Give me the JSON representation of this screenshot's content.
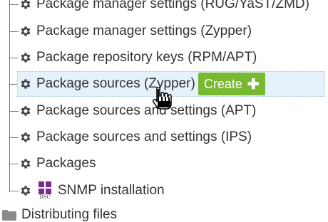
{
  "tree": {
    "items": [
      {
        "label": "Package manager settings (RUG/YaST/ZMD)",
        "icon": "gear-icon"
      },
      {
        "label": "Package manager settings (Zypper)",
        "icon": "gear-icon"
      },
      {
        "label": "Package repository keys (RPM/APT)",
        "icon": "gear-icon"
      },
      {
        "label": "Package sources (Zypper)",
        "icon": "gear-icon",
        "selected": true
      },
      {
        "label": "Package sources and settings (APT)",
        "icon": "gear-icon"
      },
      {
        "label": "Package sources and settings (IPS)",
        "icon": "gear-icon"
      },
      {
        "label": "Packages",
        "icon": "gear-icon"
      },
      {
        "label": "SNMP installation",
        "icon": "gear-icon",
        "extra_icon": "windows-icon",
        "extra_icon_caption": "DSC"
      }
    ],
    "create_button": {
      "label": "Create",
      "icon": "plus-icon"
    },
    "folder": {
      "label": "Distributing files",
      "icon": "folder-icon"
    }
  },
  "colors": {
    "highlight_bg": "#e6f2fb",
    "create_button_bg": "#79b932",
    "windows_icon": "#7b2a8c",
    "text": "#333333"
  }
}
